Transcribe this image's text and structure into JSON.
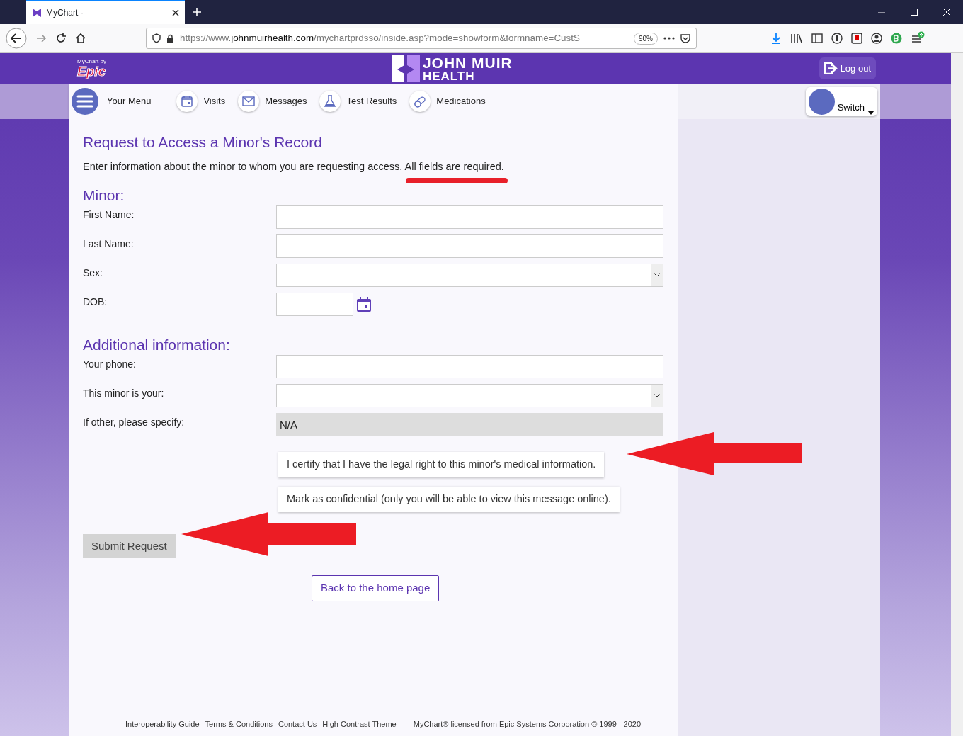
{
  "browser": {
    "tab_title": "MyChart -",
    "url_prefix": "https://www.",
    "url_domain": "johnmuirhealth.com",
    "url_path": "/mychartprdsso/inside.asp?mode=showform&formname=CustS",
    "zoom": "90%"
  },
  "header": {
    "brand_small": "MyChart by",
    "brand_big": "Epic",
    "logo_line1": "JOHN MUIR",
    "logo_line2": "HEALTH",
    "logout": "Log out"
  },
  "nav": [
    {
      "kind": "menu",
      "label": "Your Menu"
    },
    {
      "kind": "calendar",
      "label": "Visits"
    },
    {
      "kind": "envelope",
      "label": "Messages"
    },
    {
      "kind": "flask",
      "label": "Test Results"
    },
    {
      "kind": "pill",
      "label": "Medications"
    }
  ],
  "switch_label": "Switch",
  "page": {
    "title": "Request to Access a Minor's Record",
    "intro": "Enter information about the minor to whom you are requesting access.",
    "intro_required": "All fields are required."
  },
  "sections": [
    {
      "heading": "Minor:",
      "fields": [
        {
          "kind": "text",
          "label": "First Name:"
        },
        {
          "kind": "text",
          "label": "Last Name:"
        },
        {
          "kind": "select",
          "label": "Sex:"
        },
        {
          "kind": "date",
          "label": "DOB:"
        }
      ]
    },
    {
      "heading": "Additional information:",
      "fields": [
        {
          "kind": "text",
          "label": "Your phone:"
        },
        {
          "kind": "select",
          "label": "This minor is your:"
        },
        {
          "kind": "disabled",
          "label": "If other, please specify:",
          "value": "N/A"
        }
      ]
    }
  ],
  "checkboxes": [
    {
      "label": "I certify that I have the legal right to this minor's medical information.",
      "checked": false
    },
    {
      "label": "Mark as confidential (only you will be able to view this message online).",
      "checked": false
    }
  ],
  "submit": "Submit Request",
  "back": "Back to the home page",
  "footer": {
    "links": [
      "Interoperability Guide",
      "Terms & Conditions",
      "Contact Us",
      "High Contrast Theme"
    ],
    "license": "MyChart® licensed from Epic Systems Corporation © 1999 - 2020"
  }
}
